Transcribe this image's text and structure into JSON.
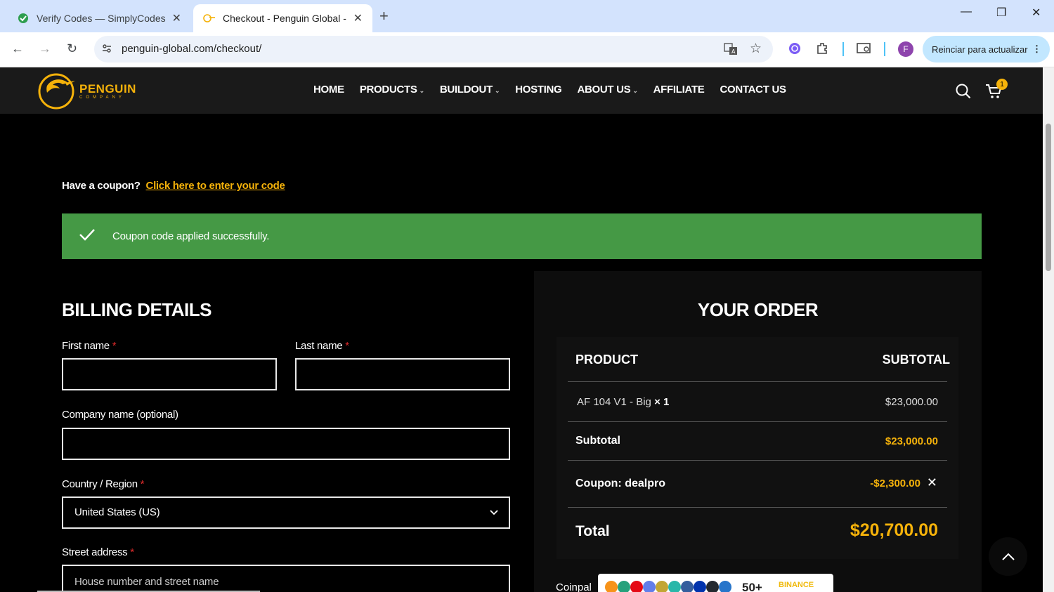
{
  "browser": {
    "tabs": [
      {
        "title": "Verify Codes — SimplyCodes",
        "active": false
      },
      {
        "title": "Checkout - Penguin Global - Cr",
        "active": true
      }
    ],
    "url": "penguin-global.com/checkout/",
    "update_button": "Reinciar para actualizar",
    "profile_initial": "F"
  },
  "site": {
    "logo_text": "PENGUIN",
    "logo_sub": "COMPANY",
    "menu": [
      {
        "label": "HOME",
        "has_dropdown": false
      },
      {
        "label": "PRODUCTS",
        "has_dropdown": true
      },
      {
        "label": "BUILDOUT",
        "has_dropdown": true
      },
      {
        "label": "HOSTING",
        "has_dropdown": false
      },
      {
        "label": "ABOUT US",
        "has_dropdown": true
      },
      {
        "label": "AFFILIATE",
        "has_dropdown": false
      },
      {
        "label": "CONTACT US",
        "has_dropdown": false
      }
    ],
    "cart_count": "1"
  },
  "checkout": {
    "coupon_prompt": "Have a coupon?",
    "coupon_link": "Click here to enter your code",
    "notice": "Coupon code applied successfully.",
    "billing_title": "BILLING DETAILS",
    "fields": {
      "first_name": {
        "label": "First name",
        "value": ""
      },
      "last_name": {
        "label": "Last name",
        "value": ""
      },
      "company": {
        "label": "Company name (optional)",
        "value": ""
      },
      "country": {
        "label": "Country / Region",
        "value": "United States (US)"
      },
      "street": {
        "label": "Street address",
        "placeholder": "House number and street name"
      }
    },
    "required_mark": "*"
  },
  "order": {
    "title": "YOUR ORDER",
    "col_product": "PRODUCT",
    "col_subtotal": "SUBTOTAL",
    "item_name": "AF 104 V1 - Big",
    "item_qty": "× 1",
    "item_price": "$23,000.00",
    "subtotal_label": "Subtotal",
    "subtotal_value": "$23,000.00",
    "coupon_label": "Coupon: dealpro",
    "coupon_value": "-$2,300.00",
    "total_label": "Total",
    "total_value": "$20,700.00",
    "payment_label": "Coinpal",
    "payment_more": "50+",
    "payment_partner": "BINANCE"
  },
  "colors": {
    "accent": "#f5b20a",
    "success": "#459945",
    "header_bg": "#1a1a1a",
    "page_bg": "#000000"
  }
}
